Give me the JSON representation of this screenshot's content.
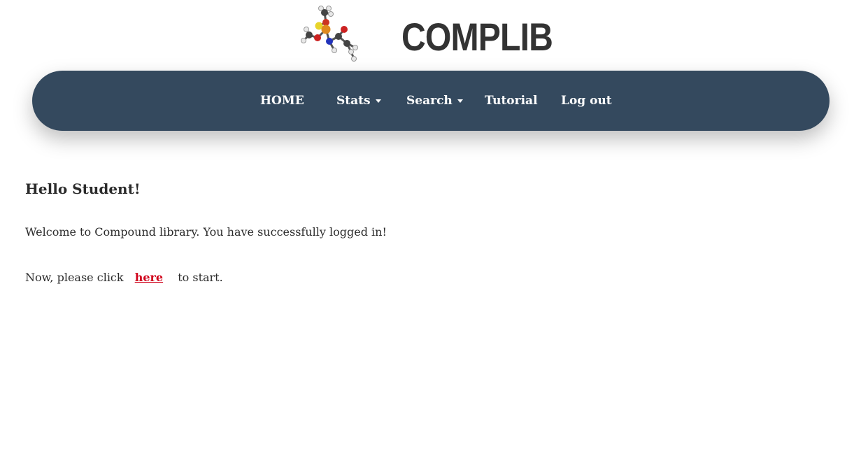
{
  "header": {
    "logo_icon": "molecule-logo-icon",
    "title": "COMPLIB"
  },
  "nav": {
    "items": [
      {
        "label": "HOME",
        "dropdown": false
      },
      {
        "label": "Stats",
        "dropdown": true
      },
      {
        "label": "Search",
        "dropdown": true
      },
      {
        "label": "Tutorial",
        "dropdown": false
      },
      {
        "label": "Log out",
        "dropdown": false
      }
    ]
  },
  "main": {
    "greeting": "Hello Student!",
    "welcome": "Welcome to Compound library. You have successfully logged in!",
    "start_prefix": "Now, please click",
    "start_link": "here",
    "start_suffix": "to start."
  },
  "colors": {
    "navbar": "#34495e",
    "link": "#d0021b",
    "text": "#2b2b2b"
  }
}
